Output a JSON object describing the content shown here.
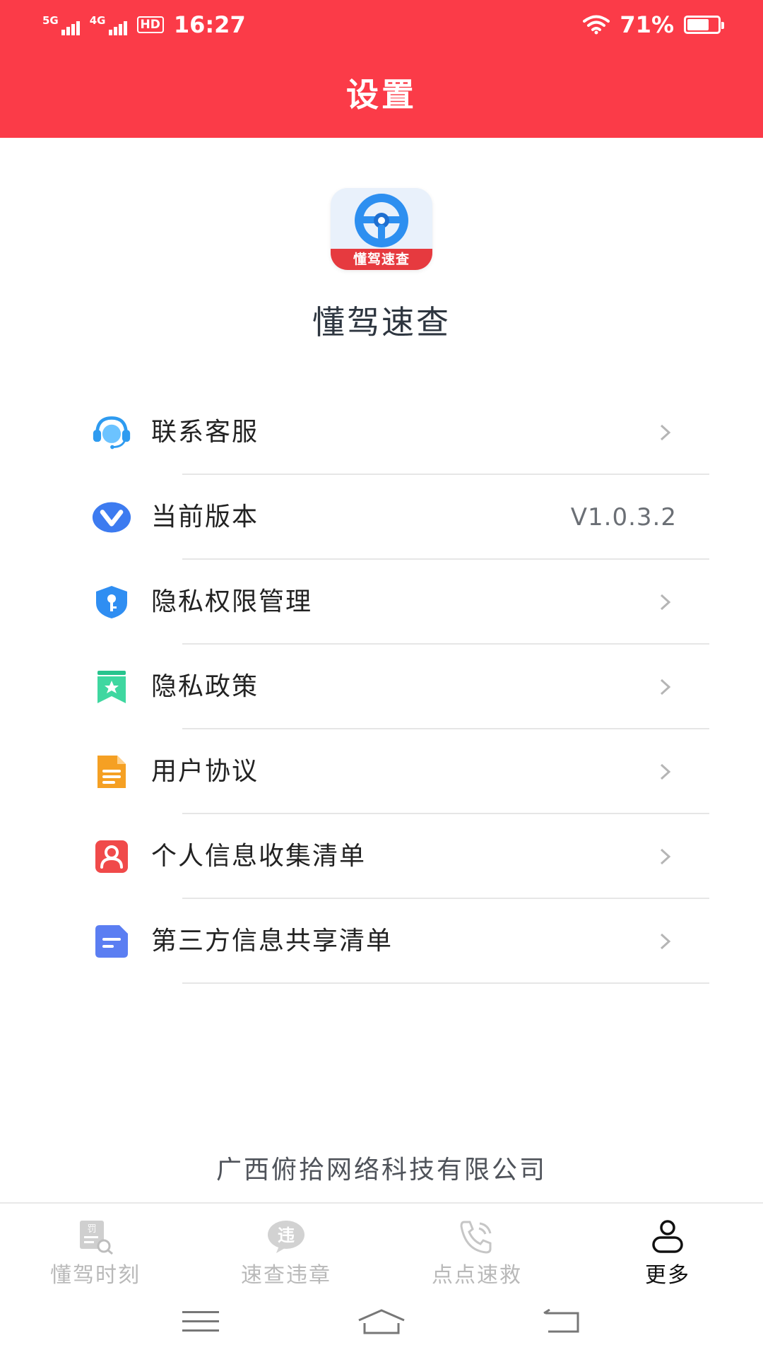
{
  "status_bar": {
    "network1": "5G",
    "network2": "4G",
    "hd": "HD",
    "time": "16:27",
    "battery": "71%",
    "battery_level": 0.71
  },
  "header": {
    "title": "设置"
  },
  "app": {
    "logo_text": "懂驾速查",
    "name": "懂驾速查"
  },
  "menu": {
    "items": [
      {
        "label": "联系客服",
        "icon": "headset-icon"
      },
      {
        "label": "当前版本",
        "icon": "version-v-icon",
        "value": "V1.0.3.2"
      },
      {
        "label": "隐私权限管理",
        "icon": "shield-key-icon"
      },
      {
        "label": "隐私政策",
        "icon": "bookmark-star-icon"
      },
      {
        "label": "用户协议",
        "icon": "document-icon"
      },
      {
        "label": "个人信息收集清单",
        "icon": "person-card-icon"
      },
      {
        "label": "第三方信息共享清单",
        "icon": "share-doc-icon"
      }
    ]
  },
  "footer": {
    "company": "广西俯拾网络科技有限公司"
  },
  "tabbar": {
    "items": [
      {
        "label": "懂驾时刻",
        "icon": "ticket-search-icon",
        "icon_text": "罚",
        "active": false
      },
      {
        "label": "速查违章",
        "icon": "chat-violation-icon",
        "icon_text": "违",
        "active": false
      },
      {
        "label": "点点速救",
        "icon": "phone-icon",
        "active": false
      },
      {
        "label": "更多",
        "icon": "user-icon",
        "active": true
      }
    ]
  },
  "colors": {
    "brand_red": "#fb3b48",
    "text_dark": "#222222",
    "text_gray": "#b9b9b9"
  }
}
